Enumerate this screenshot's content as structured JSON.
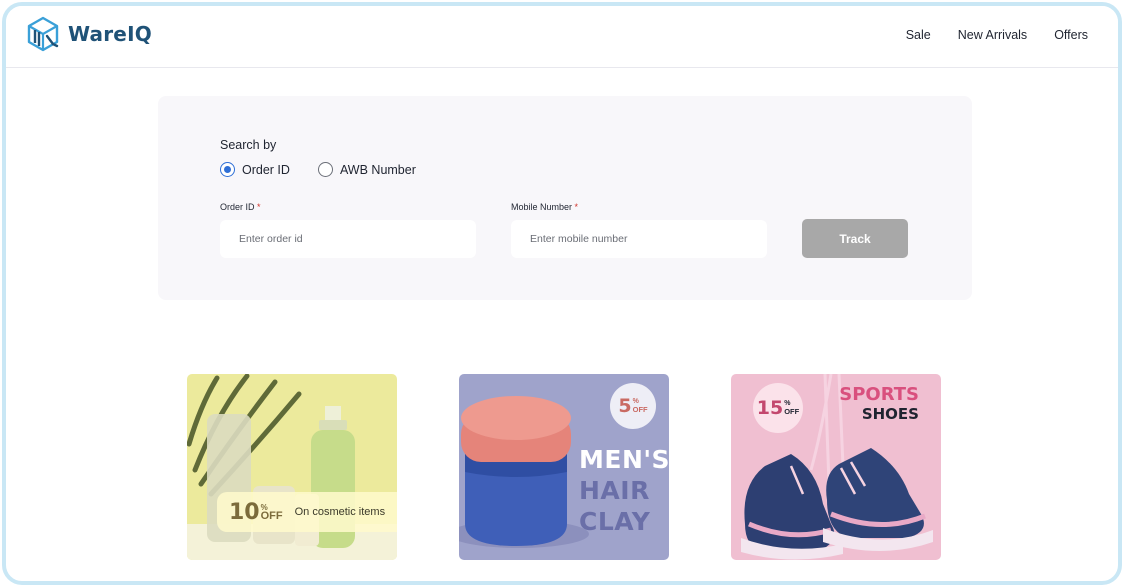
{
  "brand": {
    "name": "WareIQ",
    "color": "#1f5277",
    "accent": "#3aa0d8"
  },
  "nav": {
    "items": [
      {
        "label": "Sale"
      },
      {
        "label": "New Arrivals"
      },
      {
        "label": "Offers"
      }
    ]
  },
  "search": {
    "search_by_label": "Search by",
    "options": [
      {
        "label": "Order ID",
        "checked": true
      },
      {
        "label": "AWB Number",
        "checked": false
      }
    ],
    "order_id": {
      "label": "Order ID",
      "required_mark": "*",
      "placeholder": "Enter order id",
      "value": ""
    },
    "mobile": {
      "label": "Mobile Number",
      "required_mark": "*",
      "placeholder": "Enter mobile number",
      "value": ""
    },
    "track_label": "Track",
    "track_color": "#a8a8a8",
    "radio_color": "#2f6fd6"
  },
  "banners": [
    {
      "discount_number": "10",
      "discount_symbol": "%",
      "discount_off": "OFF",
      "text": "On cosmetic items",
      "background": "#ecea9c"
    },
    {
      "discount_number": "5",
      "discount_symbol": "%",
      "discount_off": "OFF",
      "headline": [
        "MEN'S",
        "HAIR",
        "CLAY"
      ],
      "background": "#9fa3cb"
    },
    {
      "discount_number": "15",
      "discount_symbol": "%",
      "discount_off": "OFF",
      "headline_top": "SPORTS",
      "headline_bottom": "SHOES",
      "background": "#f0bfd1"
    }
  ],
  "icons": {
    "logo": "wareiq-cube-logo-icon",
    "plant": "palm-leaf-icon",
    "jar": "hair-clay-jar-icon",
    "shoes": "sneakers-icon"
  }
}
